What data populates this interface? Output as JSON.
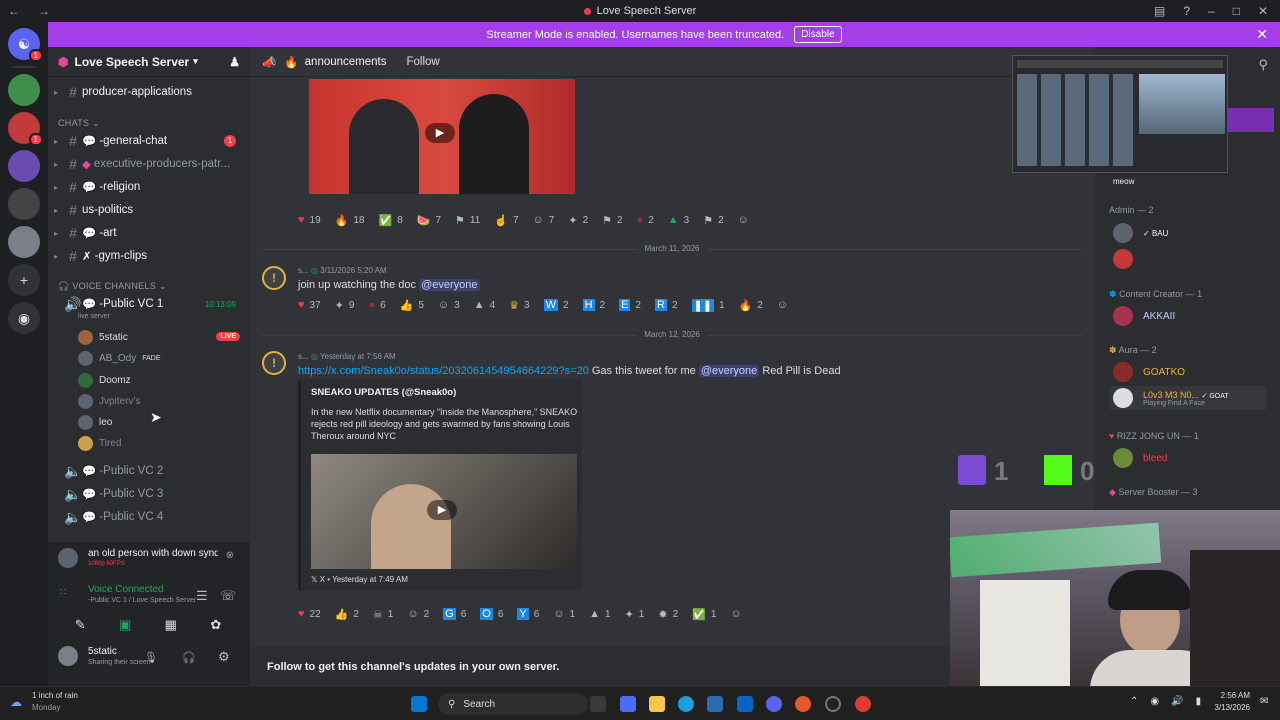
{
  "titlebar": {
    "title": "Love Speech Server"
  },
  "banner": {
    "text": "Streamer Mode is enabled. Usernames have been truncated.",
    "disable_label": "Disable"
  },
  "server": {
    "name": "Love Speech Server"
  },
  "channels": {
    "producer": "producer-applications",
    "chats_label": "CHATS",
    "general": "-general-chat",
    "general_badge": "1",
    "exec": "executive-producers-patr...",
    "religion": "-religion",
    "politics": "us-politics",
    "art": "-art",
    "gym": "-gym-clips",
    "voice_label": "VOICE CHANNELS",
    "vc1": "-Public VC 1",
    "vc1_time": "10:13:09",
    "vc1_status": "live server",
    "vc2": "-Public VC 2",
    "vc3": "-Public VC 3",
    "vc4": "-Public VC 4"
  },
  "voice_users": [
    {
      "name": "5static",
      "live": "LIVE"
    },
    {
      "name": "AB_Ody",
      "tag": "FADE"
    },
    {
      "name": "Doomz"
    },
    {
      "name": "Jvpiterv’s"
    },
    {
      "name": "leo"
    },
    {
      "name": "Tired"
    }
  ],
  "activity": {
    "title": "an old person with down syndrome ...",
    "sub": "1080p 60FPS"
  },
  "voice_conn": {
    "title": "Voice Connected",
    "sub": "-Public VC 1 / Love Speech Server"
  },
  "user": {
    "name": "5static",
    "status": "Sharing their screen"
  },
  "header": {
    "channel": "announcements",
    "follow": "Follow"
  },
  "messages": {
    "m1_reacts": [
      "19",
      "18",
      "8",
      "7",
      "11",
      "7",
      "7",
      "2",
      "2",
      "2",
      "3",
      "2"
    ],
    "date1": "March 11, 2026",
    "m2_meta": "3/11/2026 5:20 AM",
    "m2_text": "join up watching the doc",
    "m2_mention": "@everyone",
    "m2_reacts": [
      "37",
      "9",
      "6",
      "5",
      "3",
      "4",
      "3",
      "2",
      "2",
      "2",
      "2",
      "1",
      "2"
    ],
    "date2": "March 12, 2026",
    "m3_meta": "Yesterday at 7:56 AM",
    "m3_link": "https://x.com/Sneak0o/status/2032061454954664229?s=20",
    "m3_text": " Gas this tweet for me ",
    "m3_mention": "@everyone",
    "m3_tail": " Red Pill is Dead",
    "embed_author": "SNEAKO UPDATES (@Sneak0o)",
    "embed_body": "In the new Netflix documentary “Inside the Manosphere,” SNEAKO rejects red pill ideology and gets swarmed by fans showing Louis Theroux around NYC",
    "embed_footer": "X • Yesterday at 7:49 AM",
    "m3_reacts": [
      "22",
      "2",
      "1",
      "2",
      "6",
      "6",
      "6",
      "1",
      "1",
      "1",
      "2",
      "1"
    ]
  },
  "followbar": {
    "text": "Follow to get this channel's updates in your own server."
  },
  "members": {
    "meow": "meow",
    "admin": "Admin — 2",
    "bau": "BAU",
    "creator": "Content Creator — 1",
    "akkaii": "AKKAII",
    "aura": "Aura — 2",
    "goatko": "GOATKO",
    "love": "L0v3 M3 N0...",
    "goat": "GOAT",
    "love_status": "Playing Find A Face",
    "rizz": "RIZZ JONG UN — 1",
    "bleed": "bleed",
    "booster": "Server Booster — 3"
  },
  "overlay": {
    "twitch": "1",
    "kick": "0"
  },
  "taskbar": {
    "weather1": "1 inch of rain",
    "weather2": "Monday",
    "search": "Search",
    "time": "2:56 AM",
    "date": "3/13/2026"
  }
}
